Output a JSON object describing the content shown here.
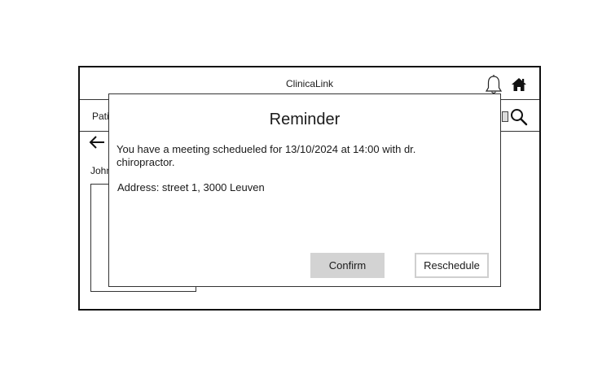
{
  "app": {
    "title": "ClinicaLink"
  },
  "nav": {
    "label": "Pati"
  },
  "patient": {
    "name": "John"
  },
  "modal": {
    "title": "Reminder",
    "message": "You have a meeting schedueled for 13/10/2024 at 14:00 with dr. chiropractor.",
    "address": "Address: street 1, 3000 Leuven",
    "confirm_label": "Confirm",
    "reschedule_label": "Reschedule"
  },
  "icons": {
    "notifications": "bell-icon",
    "home": "home-icon",
    "search": "search-icon",
    "back": "arrow-left-icon"
  },
  "colors": {
    "border": "#111111",
    "confirm_bg": "#d3d3d3",
    "reschedule_border": "#cfcfcf"
  }
}
